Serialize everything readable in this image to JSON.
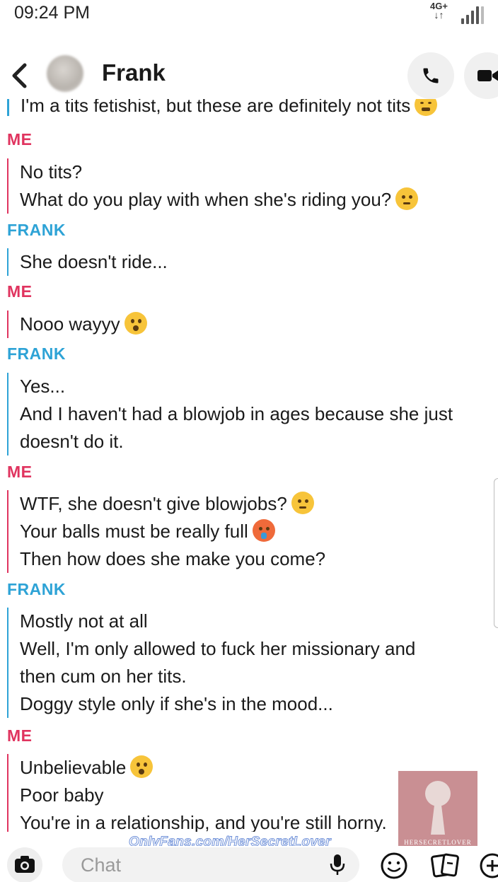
{
  "status_bar": {
    "time": "09:24 PM",
    "network": "4G+",
    "network_arrows": "↓↑"
  },
  "header": {
    "contact_name": "Frank"
  },
  "messages": {
    "partial_top": "I'm a tits fetishist, but these are definitely not tits",
    "groups": [
      {
        "sender": "ME",
        "lines": [
          "No tits?",
          "What do you play with when she's riding you?"
        ]
      },
      {
        "sender": "FRANK",
        "lines": [
          "She doesn't ride..."
        ]
      },
      {
        "sender": "ME",
        "lines": [
          "Nooo wayyy"
        ]
      },
      {
        "sender": "FRANK",
        "lines": [
          "Yes...",
          "And I haven't had a blowjob in ages because she just",
          "doesn't do it."
        ]
      },
      {
        "sender": "ME",
        "lines": [
          "WTF, she doesn't give blowjobs?",
          "Your balls must be really full",
          "Then how does she make you come?"
        ]
      },
      {
        "sender": "FRANK",
        "lines": [
          "Mostly not at all",
          "Well, I'm only allowed to fuck her missionary and",
          "then cum on her tits.",
          "Doggy style only if she's in the mood..."
        ]
      },
      {
        "sender": "ME",
        "lines": [
          "Unbelievable",
          "Poor baby",
          "You're in a relationship, and you're still horny."
        ]
      }
    ]
  },
  "watermark": {
    "url": "OnlyFans.com/HerSecretLover",
    "caption": "HERSECRETLOVER"
  },
  "input_bar": {
    "placeholder": "Chat"
  },
  "colors": {
    "me": "#e0345f",
    "frank": "#2ea3d6"
  }
}
